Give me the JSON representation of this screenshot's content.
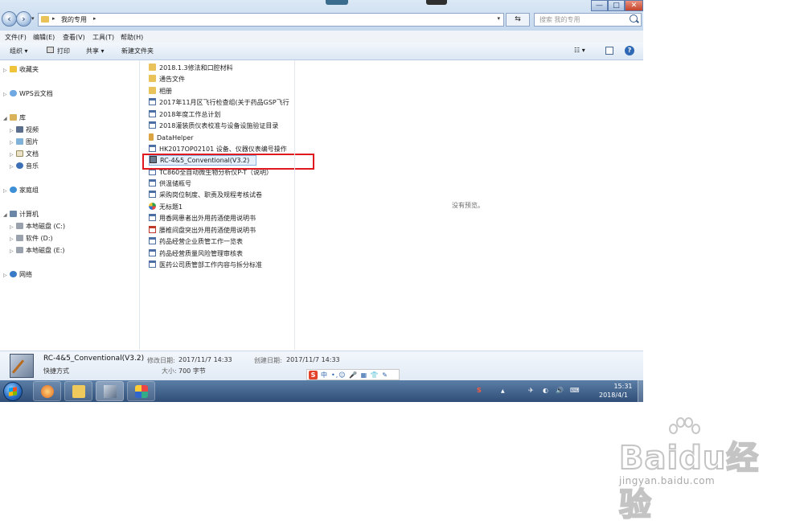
{
  "window": {
    "address": {
      "path": "我的专用"
    },
    "search_placeholder": "搜索 我的专用",
    "controls": {
      "minimize": "—",
      "maximize": "□",
      "close": "✕"
    }
  },
  "menubar": [
    "文件(F)",
    "编辑(E)",
    "查看(V)",
    "工具(T)",
    "帮助(H)"
  ],
  "toolbar": {
    "organize": "组织 ▾",
    "print": "打印",
    "share": "共享 ▾",
    "new_folder": "新建文件夹",
    "views": "☷ ▾",
    "help": "?"
  },
  "nav": {
    "favorites": "收藏夹",
    "wps": "WPS云文档",
    "libraries": "库",
    "lib_items": [
      "视频",
      "图片",
      "文档",
      "音乐"
    ],
    "homegroup": "家庭组",
    "computer": "计算机",
    "drives": [
      "本地磁盘 (C:)",
      "软件 (D:)",
      "本地磁盘 (E:)"
    ],
    "network": "网络"
  },
  "files": [
    {
      "name": "2018.1.3修法和口腔材料",
      "type": "folder"
    },
    {
      "name": "通告文件",
      "type": "folder"
    },
    {
      "name": "相册",
      "type": "folder"
    },
    {
      "name": "2017年11月区飞行检查组(关于药品GSP飞行",
      "type": "doc"
    },
    {
      "name": "2018年度工作总计划",
      "type": "doc"
    },
    {
      "name": "2018灌装质仪表校准与设备设施验证目录",
      "type": "doc"
    },
    {
      "name": "DataHelper",
      "type": "app"
    },
    {
      "name": "HK2017OP02101 设备、仪器仪表编号操作",
      "type": "doc"
    },
    {
      "name": "RC-4&5_Conventional(V3.2)",
      "type": "lnk"
    },
    {
      "name": "TC860全自动微生物分析仪P-T（说明）",
      "type": "doc"
    },
    {
      "name": "供温储瓶号",
      "type": "doc"
    },
    {
      "name": "采购岗位制度、职责及规程考核试卷",
      "type": "doc"
    },
    {
      "name": "无标题1",
      "type": "img"
    },
    {
      "name": "用香网患者出外用药酒使用说明书",
      "type": "doc"
    },
    {
      "name": "腰椎间盘突出外用药酒使用说明书",
      "type": "pdf"
    },
    {
      "name": "药品经营企业质管工作一览表",
      "type": "doc"
    },
    {
      "name": "药品经营质量风险管理审核表",
      "type": "doc"
    },
    {
      "name": "医药公司质管部工作内容与拆分标准",
      "type": "doc"
    }
  ],
  "preview": {
    "empty_text": "没有预览。"
  },
  "details": {
    "name": "RC-4&5_Conventional(V3.2)",
    "kind": "快捷方式",
    "modified_label": "修改日期:",
    "modified_value": "2017/11/7 14:33",
    "created_label": "创建日期:",
    "created_value": "2017/11/7 14:33",
    "size_label": "大小:",
    "size_value": "700 字节"
  },
  "ime": {
    "logo": "S",
    "lang": "中",
    "tools": "•,☺ 🎤 ▦ 👕 ✎"
  },
  "taskbar": {
    "tray_icons": [
      "S",
      "▲",
      "✈",
      "◐",
      "🔊",
      "⌨"
    ],
    "time": "15:31",
    "date": "2018/4/1"
  },
  "watermark": {
    "brand": "Baidu经验",
    "url": "jingyan.baidu.com"
  },
  "colors": {
    "highlight": "#e0191f",
    "taskbar": "#3d5d86",
    "folder": "#e9c35a"
  }
}
